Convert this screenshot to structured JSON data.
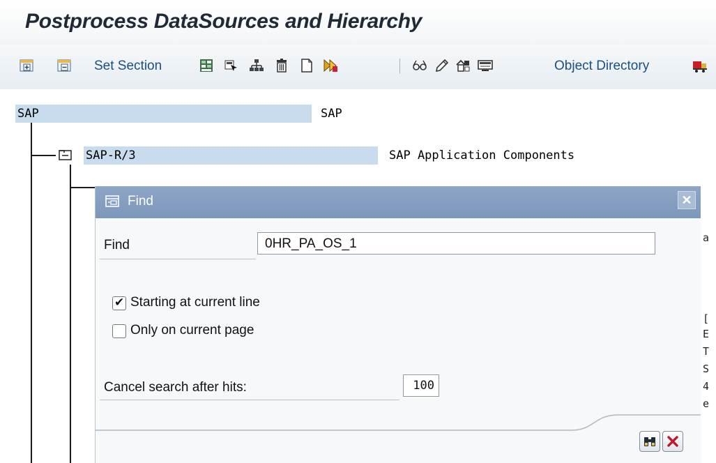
{
  "header": {
    "title": "Postprocess DataSources and Hierarchy"
  },
  "toolbar": {
    "set_section": "Set Section",
    "object_directory": "Object Directory",
    "icons": [
      "expand-subtree-icon",
      "collapse-subtree-icon",
      "select-subtree-icon",
      "select-node-icon",
      "hierarchy-icon",
      "delete-icon",
      "create-icon",
      "execute-icon",
      "display-icon",
      "change-icon",
      "transport-icon",
      "info-icon",
      "truck-icon"
    ]
  },
  "tree": {
    "root": {
      "label": "SAP",
      "description": "SAP"
    },
    "child": {
      "label": "SAP-R/3",
      "description": "SAP Application Components"
    }
  },
  "dialog": {
    "title": "Find",
    "find_label": "Find",
    "find_value": "0HR_PA_OS_1",
    "opt1_label": "Starting at current line",
    "opt1_checked": true,
    "opt2_label": "Only on current page",
    "opt2_checked": false,
    "cancel_label": "Cancel search after hits:",
    "cancel_value": "100"
  },
  "side_fragments": [
    "a",
    "[",
    "E",
    "T",
    "S",
    "4",
    "e"
  ]
}
